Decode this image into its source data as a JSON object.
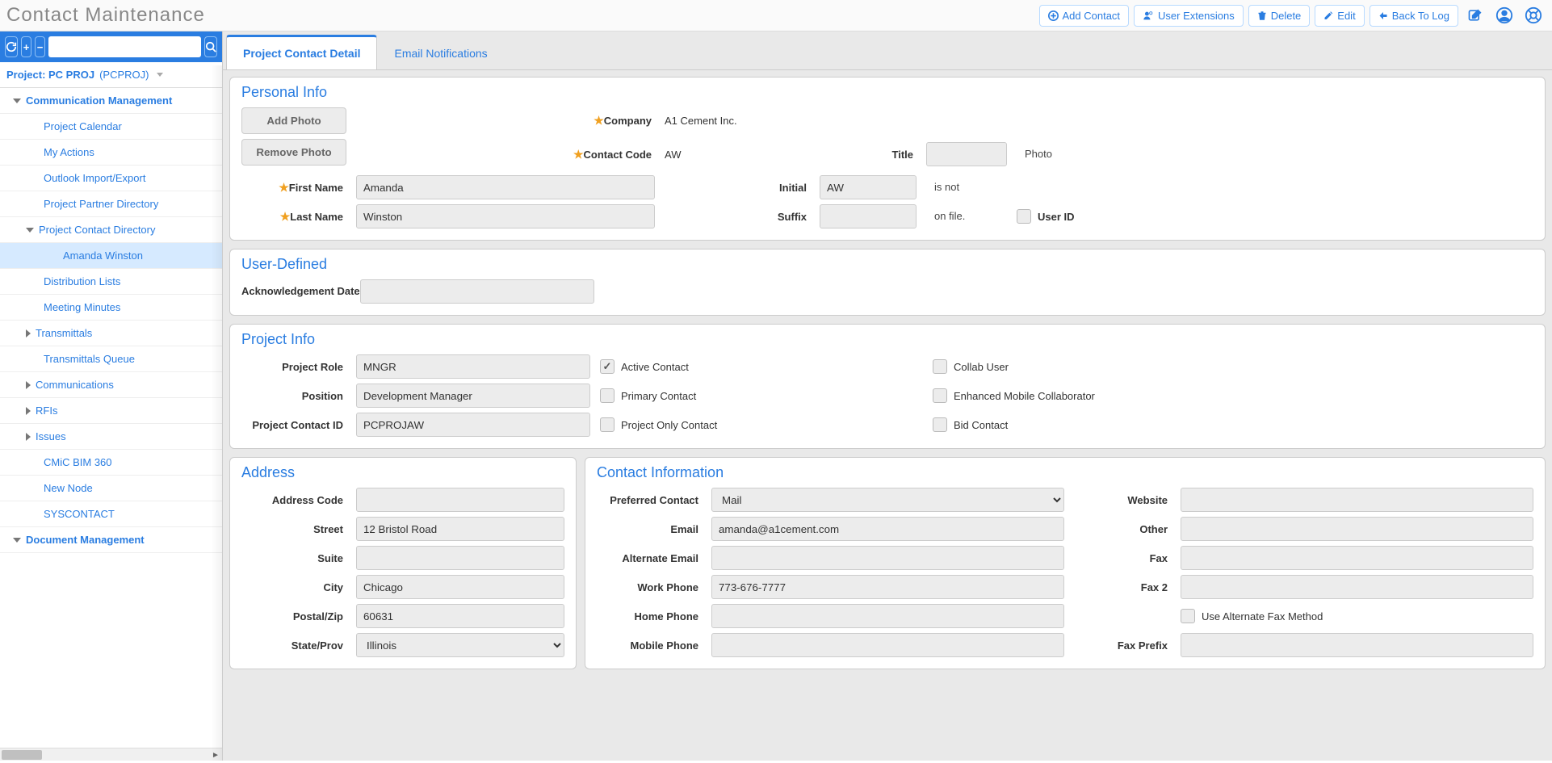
{
  "header": {
    "title": "Contact Maintenance",
    "buttons": {
      "add_contact": "Add Contact",
      "user_extensions": "User Extensions",
      "delete": "Delete",
      "edit": "Edit",
      "back_to_log": "Back To Log"
    }
  },
  "sidebar": {
    "project_label": "Project: PC PROJ",
    "project_code": "(PCPROJ)",
    "groups": {
      "comm": "Communication Management",
      "doc": "Document Management"
    },
    "items": {
      "calendar": "Project Calendar",
      "myactions": "My Actions",
      "outlook": "Outlook Import/Export",
      "partnerdir": "Project Partner Directory",
      "contactdir": "Project Contact Directory",
      "amanda": "Amanda Winston",
      "distlists": "Distribution Lists",
      "meeting": "Meeting Minutes",
      "transmittals": "Transmittals",
      "transqueue": "Transmittals Queue",
      "communications": "Communications",
      "rfis": "RFIs",
      "issues": "Issues",
      "bim360": "CMiC BIM 360",
      "newnode": "New Node",
      "syscontact": "SYSCONTACT"
    }
  },
  "tabs": {
    "detail": "Project Contact Detail",
    "email": "Email Notifications"
  },
  "personal": {
    "title": "Personal Info",
    "labels": {
      "company": "Company",
      "contact_code": "Contact Code",
      "first_name": "First Name",
      "last_name": "Last Name",
      "title_f": "Title",
      "initial": "Initial",
      "suffix": "Suffix",
      "user_id": "User ID"
    },
    "values": {
      "company": "A1 Cement Inc.",
      "contact_code": "AW",
      "first_name": "Amanda",
      "last_name": "Winston",
      "title_f": "",
      "initial": "AW",
      "suffix": ""
    },
    "photo": {
      "add": "Add Photo",
      "remove": "Remove Photo",
      "line1": "Photo",
      "line2": "is not",
      "line3": "on file."
    }
  },
  "userdef": {
    "title": "User-Defined",
    "labels": {
      "ack_date": "Acknowledgement Date"
    },
    "values": {
      "ack_date": ""
    }
  },
  "projinfo": {
    "title": "Project Info",
    "labels": {
      "role": "Project Role",
      "position": "Position",
      "pcid": "Project Contact ID"
    },
    "values": {
      "role": "MNGR",
      "position": "Development Manager",
      "pcid": "PCPROJAW"
    },
    "checks": {
      "active": "Active Contact",
      "primary": "Primary Contact",
      "projonly": "Project Only Contact",
      "collab": "Collab User",
      "emc": "Enhanced Mobile Collaborator",
      "bid": "Bid Contact"
    }
  },
  "address": {
    "title": "Address",
    "labels": {
      "code": "Address Code",
      "street": "Street",
      "suite": "Suite",
      "city": "City",
      "postal": "Postal/Zip",
      "state": "State/Prov"
    },
    "values": {
      "code": "",
      "street": "12 Bristol Road",
      "suite": "",
      "city": "Chicago",
      "postal": "60631",
      "state": "Illinois"
    }
  },
  "contact": {
    "title": "Contact Information",
    "labels": {
      "preferred": "Preferred Contact",
      "email": "Email",
      "alt_email": "Alternate Email",
      "work": "Work Phone",
      "home": "Home Phone",
      "mobile": "Mobile Phone",
      "website": "Website",
      "other": "Other",
      "fax": "Fax",
      "fax2": "Fax 2",
      "altfax": "Use Alternate Fax Method",
      "faxprefix": "Fax Prefix"
    },
    "values": {
      "preferred": "Mail",
      "email": "amanda@a1cement.com",
      "alt_email": "",
      "work": "773-676-7777",
      "home": "",
      "mobile": "",
      "website": "",
      "other": "",
      "fax": "",
      "fax2": "",
      "faxprefix": ""
    }
  }
}
